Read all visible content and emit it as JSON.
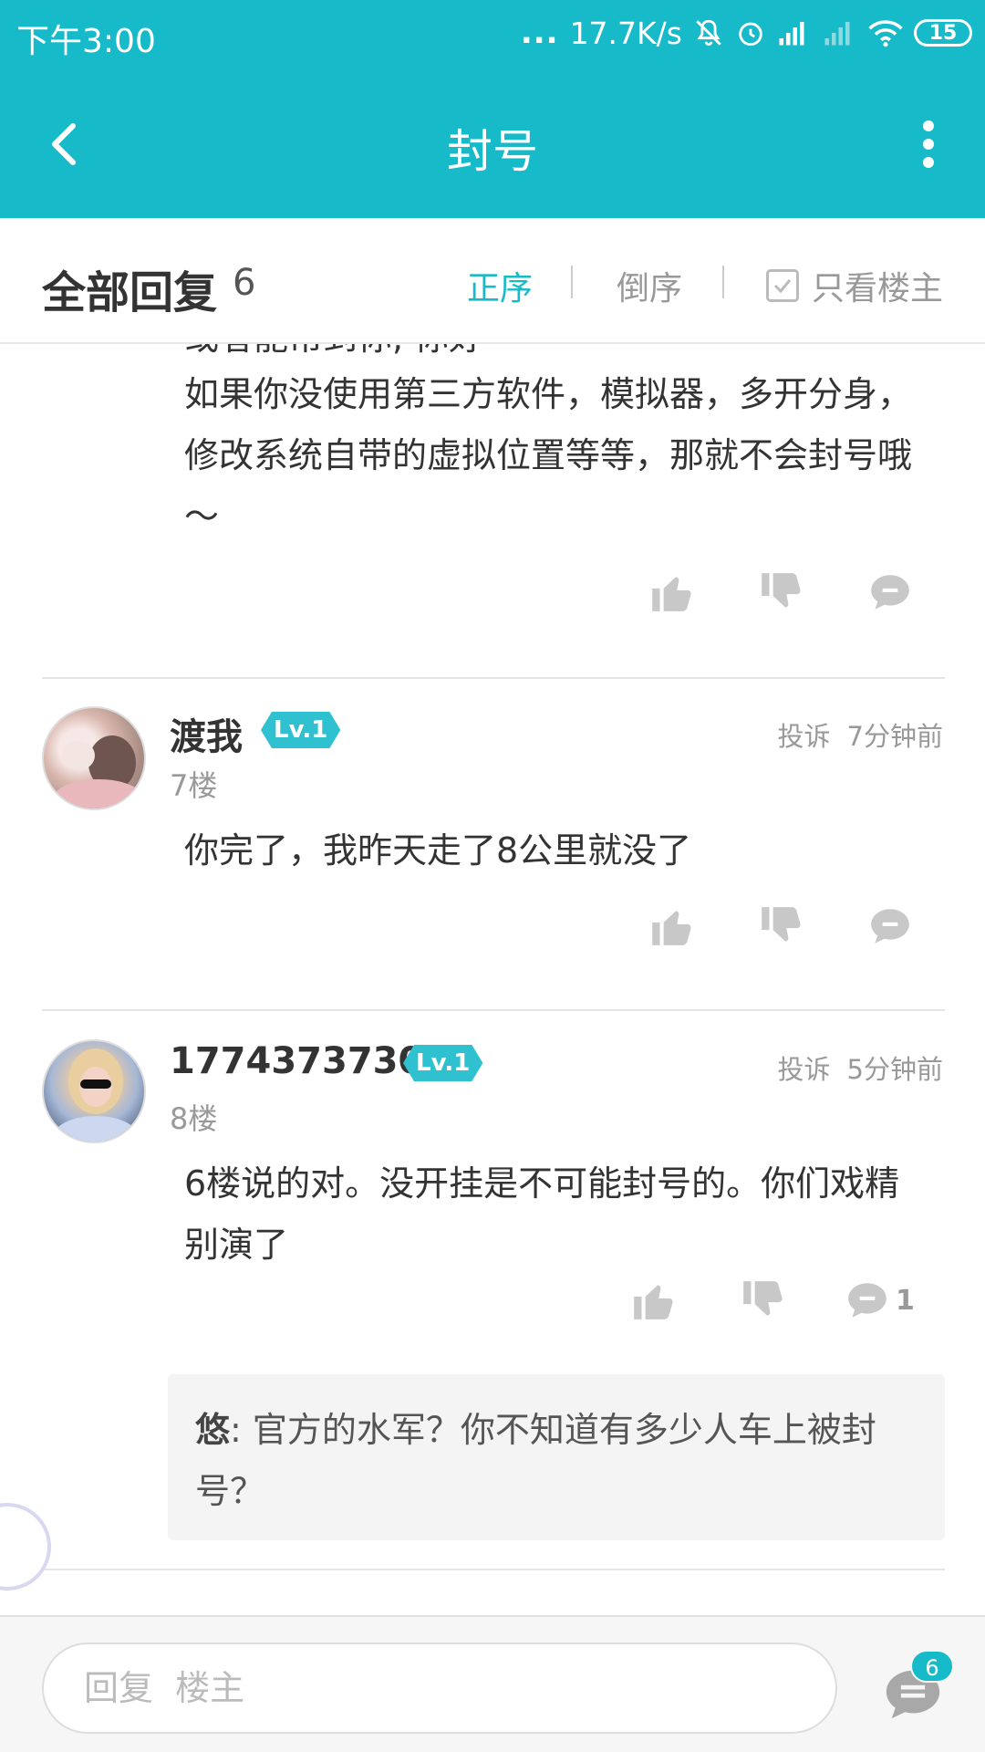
{
  "status_bar": {
    "time": "下午3:00",
    "dots": "...",
    "network_speed": "17.7K/s",
    "battery": "15"
  },
  "header": {
    "title": "封号"
  },
  "reply_bar": {
    "title": "全部回复",
    "count": "6",
    "sort_asc": "正序",
    "sort_desc": "倒序",
    "only_owner": "只看楼主"
  },
  "posts": [
    {
      "text_partial": "或者能帮到你, 你好",
      "text": "如果你没使用第三方软件，模拟器，多开分身，修改系统自带的虚拟位置等等，那就不会封号哦～"
    },
    {
      "username": "渡我",
      "level": "Lv.1",
      "floor": "7楼",
      "report": "投诉",
      "time": "7分钟前",
      "text": "你完了，我昨天走了8公里就没了"
    },
    {
      "username": "1774373730",
      "level": "Lv.1",
      "floor": "8楼",
      "report": "投诉",
      "time": "5分钟前",
      "text": "6楼说的对。没开挂是不可能封号的。你们戏精别演了",
      "comment_count": "1",
      "sub_reply": {
        "author": "悠",
        "text": ":  官方的水军？你不知道有多少人车上被封号？"
      }
    }
  ],
  "composer": {
    "placeholder": "回复  楼主",
    "badge": "6"
  },
  "colors": {
    "accent": "#17bac9",
    "level_badge": "#2fc1d0"
  }
}
